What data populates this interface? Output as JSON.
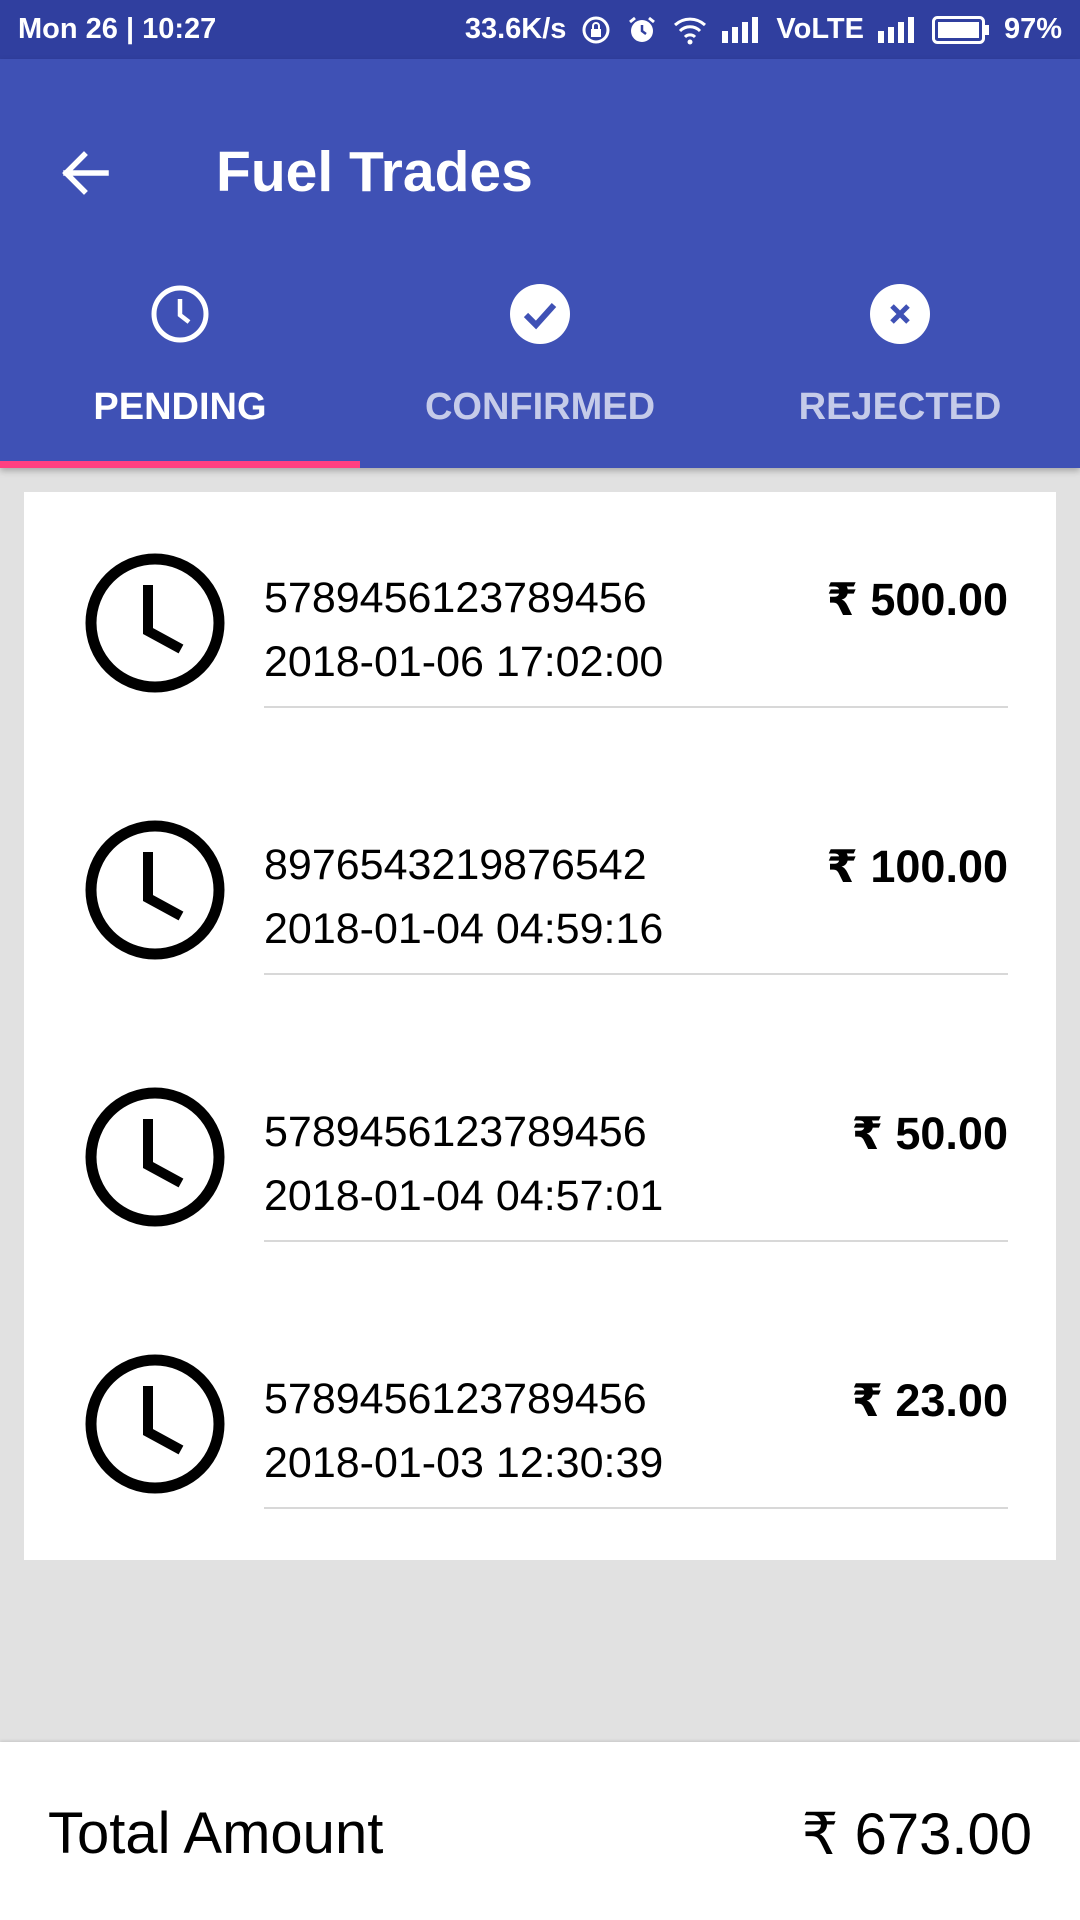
{
  "status_bar": {
    "datetime": "Mon 26 | 10:27",
    "network_speed": "33.6K/s",
    "network_type": "VoLTE",
    "battery": "97%",
    "icons": [
      "rotation-lock-icon",
      "alarm-icon",
      "wifi-icon",
      "signal-icon",
      "signal-icon",
      "battery-icon"
    ]
  },
  "app_bar": {
    "title": "Fuel Trades",
    "back_icon": "arrow-back-icon"
  },
  "tabs": [
    {
      "label": "PENDING",
      "icon": "clock-icon",
      "selected": true
    },
    {
      "label": "CONFIRMED",
      "icon": "check-circle-icon",
      "selected": false
    },
    {
      "label": "REJECTED",
      "icon": "cancel-circle-icon",
      "selected": false
    }
  ],
  "trades": [
    {
      "id": "5789456123789456",
      "datetime": "2018-01-06 17:02:00",
      "amount": "₹ 500.00"
    },
    {
      "id": "8976543219876542",
      "datetime": "2018-01-04 04:59:16",
      "amount": "₹ 100.00"
    },
    {
      "id": "5789456123789456",
      "datetime": "2018-01-04 04:57:01",
      "amount": "₹ 50.00"
    },
    {
      "id": "5789456123789456",
      "datetime": "2018-01-03 12:30:39",
      "amount": "₹ 23.00"
    }
  ],
  "footer": {
    "total_label": "Total Amount",
    "total_value": "₹ 673.00"
  },
  "colors": {
    "primary": "#3f51b5",
    "primary_dark": "#303f9f",
    "accent": "#ff4081",
    "background": "#e1e1e1"
  }
}
